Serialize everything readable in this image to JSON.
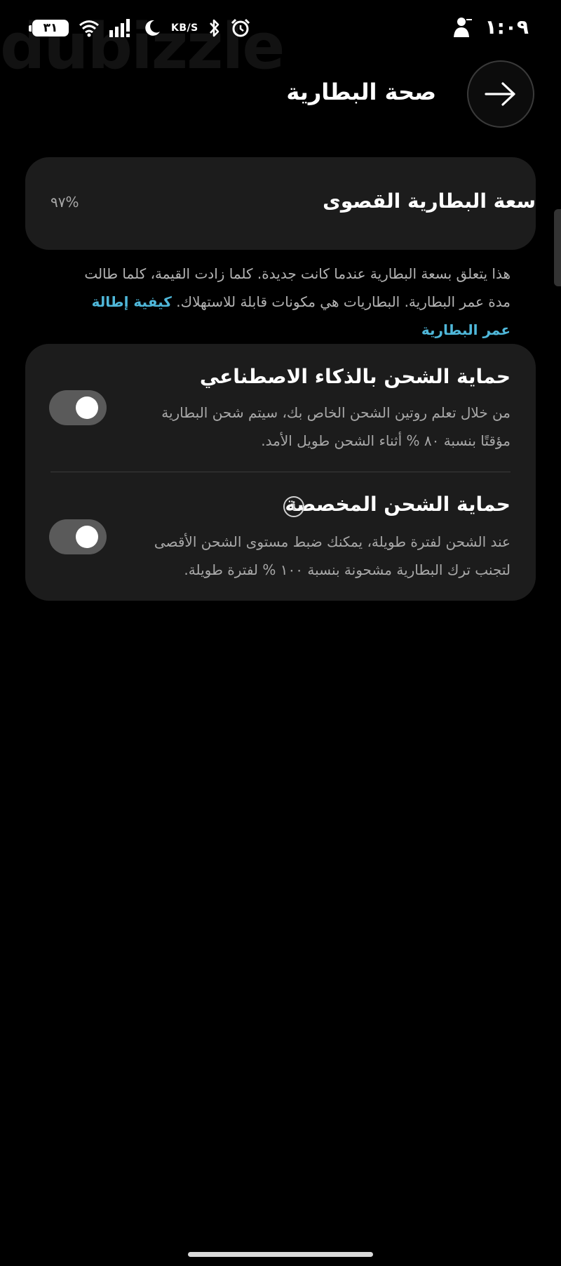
{
  "status_bar": {
    "time": "١:٠٩",
    "battery_level": "٣١",
    "speed_unit": "KB/S",
    "icons": [
      "battery-icon",
      "wifi-icon",
      "signal-icon",
      "moon-icon",
      "bluetooth-icon",
      "alarm-icon",
      "person-icon"
    ]
  },
  "header": {
    "title": "صحة البطارية",
    "back_icon": "arrow-right-icon"
  },
  "capacity_card": {
    "label": "سعة البطارية القصوى",
    "value": "%٩٧"
  },
  "description": {
    "text": "هذا يتعلق بسعة البطارية عندما كانت جديدة. كلما زادت القيمة، كلما طالت مدة عمر البطارية. البطاريات هي مكونات قابلة للاستهلاك.",
    "link": "كيفية إطالة عمر البطارية"
  },
  "protection_card": {
    "options": [
      {
        "title": "حماية الشحن بالذكاء الاصطناعي",
        "description": "من خلال تعلم روتين الشحن الخاص بك، سيتم شحن البطارية مؤقتًا بنسبة ٨٠ % أثناء الشحن طويل الأمد.",
        "enabled": true
      },
      {
        "title": "حماية الشحن المخصصة",
        "description": "عند الشحن لفترة طويلة، يمكنك ضبط مستوى الشحن الأقصى لتجنب ترك البطارية مشحونة بنسبة ١٠٠ % لفترة طويلة.",
        "enabled": true,
        "info_icon": "info-icon"
      }
    ]
  },
  "watermark": "dubizzle",
  "colors": {
    "background": "#000000",
    "card": "#1c1c1c",
    "link": "#4fb7d9",
    "toggle_track": "#5a5a5a"
  }
}
